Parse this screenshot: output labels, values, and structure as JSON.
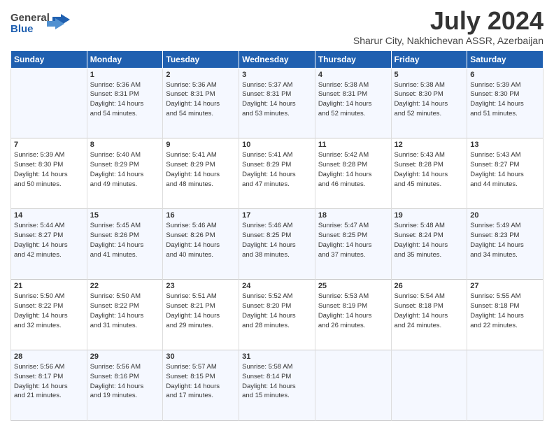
{
  "header": {
    "logo_general": "General",
    "logo_blue": "Blue",
    "month": "July 2024",
    "location": "Sharur City, Nakhichevan ASSR, Azerbaijan"
  },
  "weekdays": [
    "Sunday",
    "Monday",
    "Tuesday",
    "Wednesday",
    "Thursday",
    "Friday",
    "Saturday"
  ],
  "weeks": [
    [
      {
        "day": "",
        "info": ""
      },
      {
        "day": "1",
        "info": "Sunrise: 5:36 AM\nSunset: 8:31 PM\nDaylight: 14 hours\nand 54 minutes."
      },
      {
        "day": "2",
        "info": "Sunrise: 5:36 AM\nSunset: 8:31 PM\nDaylight: 14 hours\nand 54 minutes."
      },
      {
        "day": "3",
        "info": "Sunrise: 5:37 AM\nSunset: 8:31 PM\nDaylight: 14 hours\nand 53 minutes."
      },
      {
        "day": "4",
        "info": "Sunrise: 5:38 AM\nSunset: 8:31 PM\nDaylight: 14 hours\nand 52 minutes."
      },
      {
        "day": "5",
        "info": "Sunrise: 5:38 AM\nSunset: 8:30 PM\nDaylight: 14 hours\nand 52 minutes."
      },
      {
        "day": "6",
        "info": "Sunrise: 5:39 AM\nSunset: 8:30 PM\nDaylight: 14 hours\nand 51 minutes."
      }
    ],
    [
      {
        "day": "7",
        "info": "Sunrise: 5:39 AM\nSunset: 8:30 PM\nDaylight: 14 hours\nand 50 minutes."
      },
      {
        "day": "8",
        "info": "Sunrise: 5:40 AM\nSunset: 8:29 PM\nDaylight: 14 hours\nand 49 minutes."
      },
      {
        "day": "9",
        "info": "Sunrise: 5:41 AM\nSunset: 8:29 PM\nDaylight: 14 hours\nand 48 minutes."
      },
      {
        "day": "10",
        "info": "Sunrise: 5:41 AM\nSunset: 8:29 PM\nDaylight: 14 hours\nand 47 minutes."
      },
      {
        "day": "11",
        "info": "Sunrise: 5:42 AM\nSunset: 8:28 PM\nDaylight: 14 hours\nand 46 minutes."
      },
      {
        "day": "12",
        "info": "Sunrise: 5:43 AM\nSunset: 8:28 PM\nDaylight: 14 hours\nand 45 minutes."
      },
      {
        "day": "13",
        "info": "Sunrise: 5:43 AM\nSunset: 8:27 PM\nDaylight: 14 hours\nand 44 minutes."
      }
    ],
    [
      {
        "day": "14",
        "info": "Sunrise: 5:44 AM\nSunset: 8:27 PM\nDaylight: 14 hours\nand 42 minutes."
      },
      {
        "day": "15",
        "info": "Sunrise: 5:45 AM\nSunset: 8:26 PM\nDaylight: 14 hours\nand 41 minutes."
      },
      {
        "day": "16",
        "info": "Sunrise: 5:46 AM\nSunset: 8:26 PM\nDaylight: 14 hours\nand 40 minutes."
      },
      {
        "day": "17",
        "info": "Sunrise: 5:46 AM\nSunset: 8:25 PM\nDaylight: 14 hours\nand 38 minutes."
      },
      {
        "day": "18",
        "info": "Sunrise: 5:47 AM\nSunset: 8:25 PM\nDaylight: 14 hours\nand 37 minutes."
      },
      {
        "day": "19",
        "info": "Sunrise: 5:48 AM\nSunset: 8:24 PM\nDaylight: 14 hours\nand 35 minutes."
      },
      {
        "day": "20",
        "info": "Sunrise: 5:49 AM\nSunset: 8:23 PM\nDaylight: 14 hours\nand 34 minutes."
      }
    ],
    [
      {
        "day": "21",
        "info": "Sunrise: 5:50 AM\nSunset: 8:22 PM\nDaylight: 14 hours\nand 32 minutes."
      },
      {
        "day": "22",
        "info": "Sunrise: 5:50 AM\nSunset: 8:22 PM\nDaylight: 14 hours\nand 31 minutes."
      },
      {
        "day": "23",
        "info": "Sunrise: 5:51 AM\nSunset: 8:21 PM\nDaylight: 14 hours\nand 29 minutes."
      },
      {
        "day": "24",
        "info": "Sunrise: 5:52 AM\nSunset: 8:20 PM\nDaylight: 14 hours\nand 28 minutes."
      },
      {
        "day": "25",
        "info": "Sunrise: 5:53 AM\nSunset: 8:19 PM\nDaylight: 14 hours\nand 26 minutes."
      },
      {
        "day": "26",
        "info": "Sunrise: 5:54 AM\nSunset: 8:18 PM\nDaylight: 14 hours\nand 24 minutes."
      },
      {
        "day": "27",
        "info": "Sunrise: 5:55 AM\nSunset: 8:18 PM\nDaylight: 14 hours\nand 22 minutes."
      }
    ],
    [
      {
        "day": "28",
        "info": "Sunrise: 5:56 AM\nSunset: 8:17 PM\nDaylight: 14 hours\nand 21 minutes."
      },
      {
        "day": "29",
        "info": "Sunrise: 5:56 AM\nSunset: 8:16 PM\nDaylight: 14 hours\nand 19 minutes."
      },
      {
        "day": "30",
        "info": "Sunrise: 5:57 AM\nSunset: 8:15 PM\nDaylight: 14 hours\nand 17 minutes."
      },
      {
        "day": "31",
        "info": "Sunrise: 5:58 AM\nSunset: 8:14 PM\nDaylight: 14 hours\nand 15 minutes."
      },
      {
        "day": "",
        "info": ""
      },
      {
        "day": "",
        "info": ""
      },
      {
        "day": "",
        "info": ""
      }
    ]
  ]
}
